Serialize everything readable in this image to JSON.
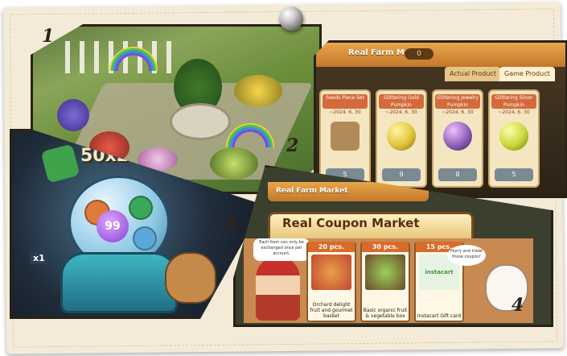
{
  "labels": {
    "n1": "1",
    "n2": "2",
    "n3": "3",
    "n4": "4"
  },
  "colors": {
    "board": "#f4ead8",
    "frame": "#2a2116",
    "header_orange": "#e9a64a",
    "tag_red": "#d46a3b"
  },
  "shop": {
    "header_title": "Real Farm Market",
    "coins": "0",
    "tabs": [
      "Actual Product",
      "Game Product"
    ],
    "cards": [
      {
        "name": "Seeds Piece Set",
        "date": "~2024. 6. 30",
        "price": "5",
        "orb_color": "#b08a5a"
      },
      {
        "name": "Glittering Gold Pumpkin",
        "date": "~2024. 6. 30",
        "price": "9",
        "orb_color": "#e2c63a"
      },
      {
        "name": "Glittering Jewelry Pumpkin",
        "date": "~2024. 6. 30",
        "price": "8",
        "orb_color": "#8f5fb8"
      },
      {
        "name": "Glittering Silver Pumpkin",
        "date": "~2024. 6. 30",
        "price": "5",
        "orb_color": "#cbd63a"
      }
    ]
  },
  "gacha": {
    "multiplier": "50x2",
    "ball_number": "99",
    "side_label": "x1"
  },
  "coupon": {
    "header_title": "Real Farm Market",
    "title": "Real Coupon Market",
    "speech": "Each item can only be exchanged once per account.",
    "dog_speech": "Hurry and trade those coupon!",
    "items": [
      {
        "qty": "20 pcs.",
        "label": "Orchard delight fruit and gourmet basket",
        "color": "#c0472f"
      },
      {
        "qty": "30 pcs.",
        "label": "Basic organic fruit & vegetable box",
        "color": "#6a9c3a"
      },
      {
        "qty": "15 pcs.",
        "label": "Instacart Gift card",
        "color": "#e7f3e2",
        "brand": "instacart"
      }
    ]
  }
}
